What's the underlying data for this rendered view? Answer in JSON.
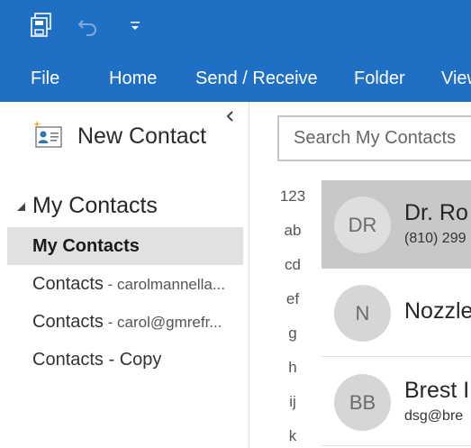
{
  "quick_access": {
    "save_icon": "save-all-icon",
    "undo_icon": "undo-icon",
    "customize_icon": "chevron-down-icon"
  },
  "ribbon": {
    "tabs": [
      {
        "label": "File"
      },
      {
        "label": "Home"
      },
      {
        "label": "Send / Receive"
      },
      {
        "label": "Folder"
      },
      {
        "label": "View"
      }
    ]
  },
  "left_pane": {
    "new_contact_label": "New Contact",
    "folder_group_label": "My Contacts",
    "folders": [
      {
        "label": "My Contacts",
        "account": "",
        "selected": true
      },
      {
        "label": "Contacts",
        "account": " - carolmannella...",
        "selected": false
      },
      {
        "label": "Contacts",
        "account": " - carol@gmrefr...",
        "selected": false
      },
      {
        "label": "Contacts - Copy",
        "account": "",
        "selected": false
      }
    ]
  },
  "search": {
    "placeholder": "Search My Contacts"
  },
  "index": [
    "123",
    "ab",
    "cd",
    "ef",
    "g",
    "h",
    "ij",
    "k"
  ],
  "contacts": [
    {
      "initials": "DR",
      "name": "Dr. Ro",
      "detail": "(810) 299",
      "selected": true
    },
    {
      "initials": "N",
      "name": "Nozzle",
      "detail": "",
      "selected": false
    },
    {
      "initials": "BB",
      "name": "Brest I",
      "detail": "dsg@bre",
      "selected": false
    }
  ],
  "colors": {
    "ribbon_blue": "#1f6fc5",
    "selected_folder_bg": "#e1e1e1",
    "selected_card_bg": "#c8c8c8"
  }
}
